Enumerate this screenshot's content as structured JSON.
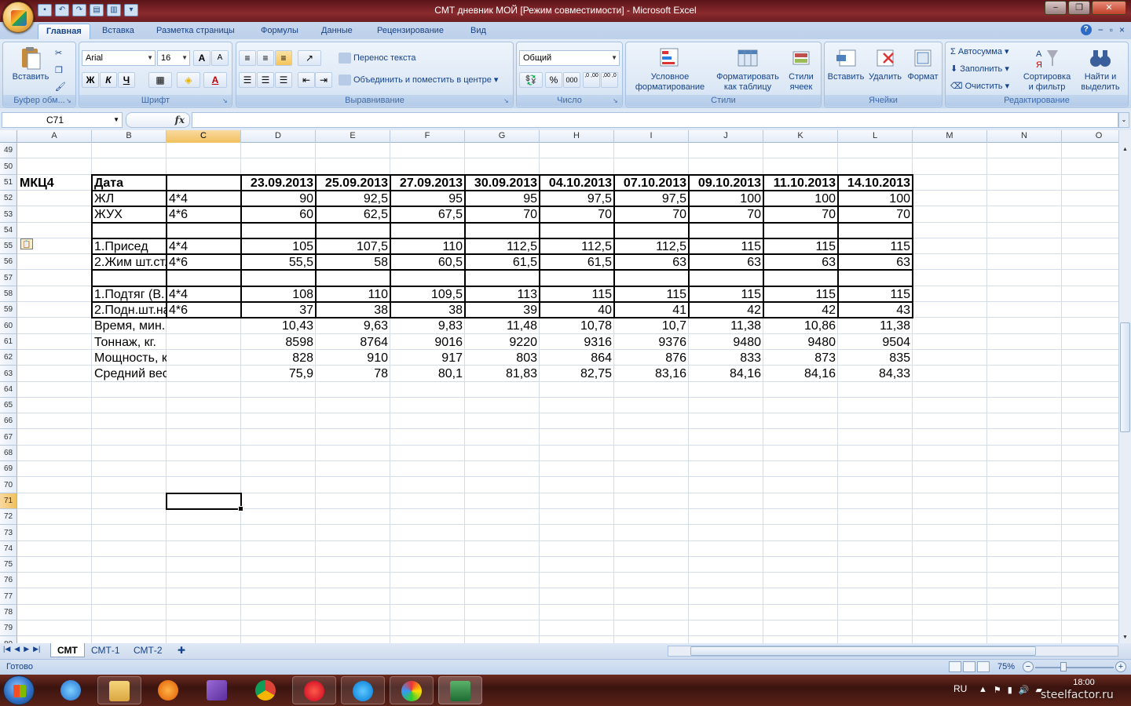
{
  "window": {
    "title": "СМТ дневник МОЙ  [Режим совместимости]  -  Microsoft Excel",
    "controls": [
      "−",
      "❐",
      "✕"
    ]
  },
  "quick_access": {
    "icons": [
      "save-icon",
      "undo-icon",
      "redo-icon",
      "print-preview-icon",
      "quick-print-icon",
      "customize-icon"
    ]
  },
  "ribbon_tabs": [
    "Главная",
    "Вставка",
    "Разметка страницы",
    "Формулы",
    "Данные",
    "Рецензирование",
    "Вид"
  ],
  "ribbon": {
    "clipboard": {
      "label": "Буфер обм...",
      "paste": "Вставить"
    },
    "font": {
      "label": "Шрифт",
      "name": "Arial",
      "size": "16",
      "bold": "Ж",
      "italic": "К",
      "underline": "Ч",
      "grow": "A",
      "shrink": "A",
      "color_letter": "A"
    },
    "alignment": {
      "label": "Выравнивание",
      "wrap": "Перенос текста",
      "merge": "Объединить и поместить в центре"
    },
    "number": {
      "label": "Число",
      "format": "Общий",
      "percent": "%",
      "thousands": "000",
      "inc_dec": ",0 ,00",
      "dec_dec": ",00 ,0"
    },
    "styles": {
      "label": "Стили",
      "conditional": "Условное форматирование",
      "as_table": "Форматировать как таблицу",
      "cell_styles": "Стили ячеек"
    },
    "cells": {
      "label": "Ячейки",
      "insert": "Вставить",
      "delete": "Удалить",
      "format": "Формат"
    },
    "editing": {
      "label": "Редактирование",
      "autosum": "Автосумма",
      "fill": "Заполнить",
      "clear": "Очистить",
      "sort": "Сортировка и фильтр",
      "find": "Найти и выделить"
    }
  },
  "formula_bar": {
    "name_box": "C71",
    "fx": "fx",
    "formula": ""
  },
  "columns": [
    "A",
    "B",
    "C",
    "D",
    "E",
    "F",
    "G",
    "H",
    "I",
    "J",
    "K",
    "L",
    "M",
    "N",
    "O"
  ],
  "selected_column": "C",
  "rows": [
    "49",
    "50",
    "51",
    "52",
    "53",
    "54",
    "55",
    "56",
    "57",
    "58",
    "59",
    "60",
    "61",
    "62",
    "63",
    "64",
    "65",
    "66",
    "67",
    "68",
    "69",
    "70",
    "71",
    "72",
    "73",
    "74",
    "75",
    "76",
    "77",
    "78",
    "79",
    "80"
  ],
  "selected_row": "71",
  "sheet": {
    "label_a51": "МКЦ4",
    "header": {
      "b": "Дата",
      "dates": [
        "23.09.2013",
        "25.09.2013",
        "27.09.2013",
        "30.09.2013",
        "04.10.2013",
        "07.10.2013",
        "09.10.2013",
        "11.10.2013",
        "14.10.2013"
      ]
    },
    "data_rows": [
      {
        "row": "52",
        "b": "ЖЛ",
        "c": "4*4",
        "values": [
          "90",
          "92,5",
          "95",
          "95",
          "97,5",
          "97,5",
          "100",
          "100",
          "100"
        ]
      },
      {
        "row": "53",
        "b": "ЖУХ",
        "c": "4*6",
        "values": [
          "60",
          "62,5",
          "67,5",
          "70",
          "70",
          "70",
          "70",
          "70",
          "70"
        ]
      },
      {
        "row": "55",
        "b": "1.Присед",
        "c": "4*4",
        "values": [
          "105",
          "107,5",
          "110",
          "112,5",
          "112,5",
          "112,5",
          "115",
          "115",
          "115"
        ]
      },
      {
        "row": "56",
        "b": "2.Жим шт.ст.",
        "c": "4*6",
        "values": [
          "55,5",
          "58",
          "60,5",
          "61,5",
          "61,5",
          "63",
          "63",
          "63",
          "63"
        ]
      },
      {
        "row": "58",
        "b": "1.Подтяг (В.",
        "c": "4*4",
        "values": [
          "108",
          "110",
          "109,5",
          "113",
          "115",
          "115",
          "115",
          "115",
          "115"
        ]
      },
      {
        "row": "59",
        "b": "2.Подн.шт.на",
        "c": "4*6",
        "values": [
          "37",
          "38",
          "38",
          "39",
          "40",
          "41",
          "42",
          "42",
          "43"
        ]
      },
      {
        "row": "60",
        "b": "Время, мин.",
        "c": "",
        "values": [
          "10,43",
          "9,63",
          "9,83",
          "11,48",
          "10,78",
          "10,7",
          "11,38",
          "10,86",
          "11,38"
        ]
      },
      {
        "row": "61",
        "b": "Тоннаж, кг.",
        "c": "",
        "values": [
          "8598",
          "8764",
          "9016",
          "9220",
          "9316",
          "9376",
          "9480",
          "9480",
          "9504"
        ]
      },
      {
        "row": "62",
        "b": "Мощность, кг/мин.",
        "c": "",
        "values": [
          "828",
          "910",
          "917",
          "803",
          "864",
          "876",
          "833",
          "873",
          "835"
        ]
      },
      {
        "row": "63",
        "b": "Средний вес, кг.",
        "c": "",
        "values": [
          "75,9",
          "78",
          "80,1",
          "81,83",
          "82,75",
          "83,16",
          "84,16",
          "84,16",
          "84,33"
        ]
      }
    ]
  },
  "sheet_tabs": [
    "СМТ",
    "СМТ-1",
    "СМТ-2"
  ],
  "active_sheet": "СМТ",
  "status": {
    "text": "Готово",
    "zoom": "75%"
  },
  "taskbar": {
    "apps": [
      "ie-icon",
      "explorer-icon",
      "avast-icon",
      "visual-studio-icon",
      "chrome-icon",
      "yandex-icon",
      "skype-icon",
      "paint-icon",
      "excel-icon"
    ],
    "lang": "RU",
    "clock": "18:00"
  },
  "watermark": "steelfactor.ru"
}
